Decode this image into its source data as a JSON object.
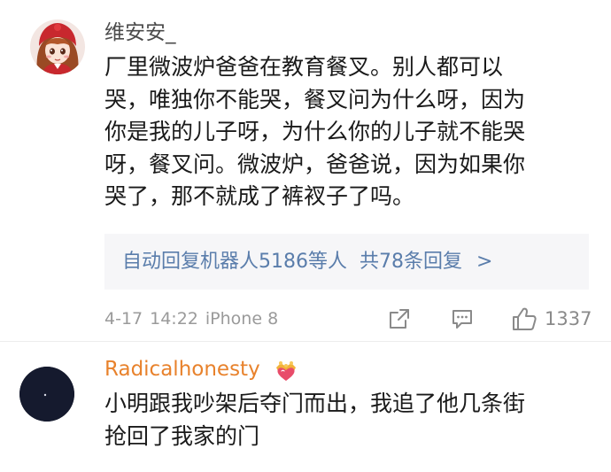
{
  "comments": [
    {
      "username": "维安安_",
      "avatar": "anime-girl-avatar",
      "lines": [
        "厂里微波炉爸爸在教育餐叉。别人都可以",
        "哭，唯独你不能哭，餐叉问为什么呀，因为",
        "你是我的儿子呀，为什么你的儿子就不能哭",
        "呀，餐叉问。微波炉，爸爸说，因为如果你",
        "哭了，那不就成了裤衩子了吗。"
      ],
      "replies": {
        "repliers": "自动回复机器人5186等人",
        "total": "共78条回复",
        "chevron": ">"
      },
      "meta": {
        "date": "4-17",
        "time": "14:22",
        "device": "iPhone 8"
      },
      "actions": {
        "share_icon": "share-icon",
        "comment_icon": "comment-icon",
        "like_icon": "thumbs-up-icon",
        "like_count": "1337"
      }
    },
    {
      "username": "Radicalhonesty",
      "avatar": "dark-avatar",
      "badge": "crown-heart-badge-icon",
      "username_color": "#e8822c",
      "lines": [
        "小明跟我吵架后夺门而出，我追了他几条街",
        "抢回了我家的门"
      ]
    }
  ],
  "colors": {
    "text": "#1a1a1a",
    "username_gray": "#4b4b4b",
    "link_blue": "#5a7dab",
    "meta_gray": "#9a9a9a",
    "reply_bg": "#f6f6f8"
  }
}
